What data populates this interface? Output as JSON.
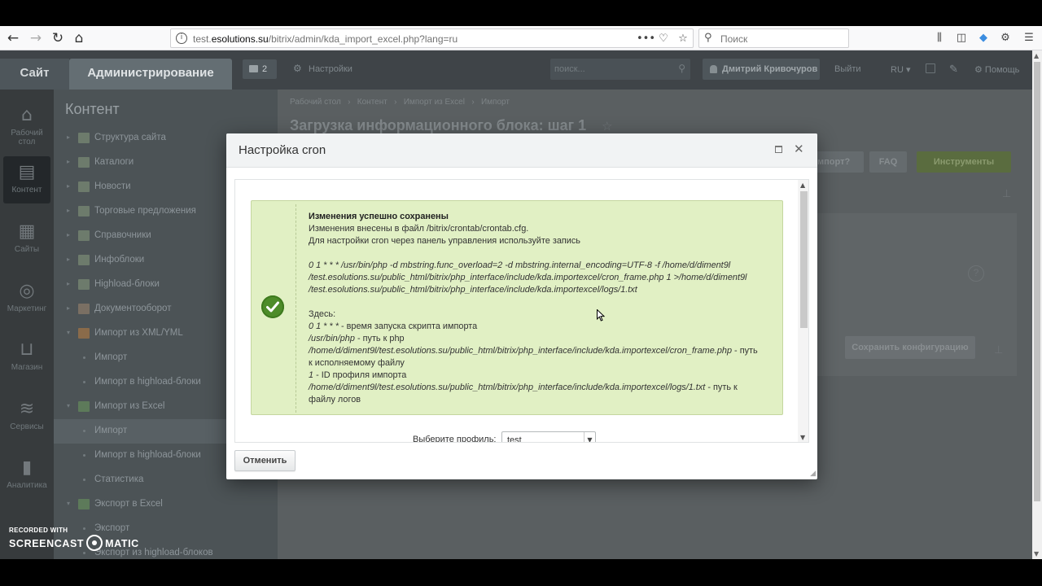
{
  "browser": {
    "url_prefix": "test.",
    "url_domain": "esolutions.su",
    "url_path": "/bitrix/admin/kda_import_excel.php?lang=ru",
    "search_placeholder": "Поиск",
    "more_icon": "•••"
  },
  "header": {
    "site_tab": "Сайт",
    "admin_tab": "Администрирование",
    "notifications_count": "2",
    "settings_label": "Настройки",
    "search_placeholder": "поиск...",
    "user_name": "Дмитрий Кривочуров",
    "logout_label": "Выйти",
    "lang_label": "RU",
    "help_label": "Помощь"
  },
  "leftbar": {
    "items": [
      {
        "label1": "Рабочий",
        "label2": "стол",
        "icon": "home-icon"
      },
      {
        "label1": "Контент",
        "label2": "",
        "icon": "document-icon"
      },
      {
        "label1": "Сайты",
        "label2": "",
        "icon": "calendar-icon"
      },
      {
        "label1": "Маркетинг",
        "label2": "",
        "icon": "target-icon"
      },
      {
        "label1": "Магазин",
        "label2": "",
        "icon": "basket-icon"
      },
      {
        "label1": "Сервисы",
        "label2": "",
        "icon": "layers-icon"
      },
      {
        "label1": "Аналитика",
        "label2": "",
        "icon": "bar-chart-icon"
      }
    ]
  },
  "submenu": {
    "title": "Контент",
    "items": [
      "Структура сайта",
      "Каталоги",
      "Новости",
      "Торговые предложения",
      "Справочники",
      "Инфоблоки",
      "Highload-блоки",
      "Документооборот",
      "Импорт из XML/YML"
    ],
    "xml_children": [
      "Импорт",
      "Импорт в highload-блоки"
    ],
    "excel_group": "Импорт из Excel",
    "excel_children": [
      "Импорт",
      "Импорт в highload-блоки",
      "Статистика"
    ],
    "export_group": "Экспорт в Excel",
    "export_children": [
      "Экспорт",
      "Экспорт из highload-блоков"
    ]
  },
  "main": {
    "breadcrumbs": [
      "Рабочий стол",
      "Контент",
      "Импорт из Excel",
      "Импорт"
    ],
    "title": "Загрузка информационного блока: шаг 1",
    "btn_import": "мпорт?",
    "btn_faq": "FAQ",
    "btn_tools": "Инструменты",
    "btn_save": "Сохранить конфигурацию"
  },
  "dialog": {
    "title": "Настройка cron",
    "message": {
      "heading": "Изменения успешно сохранены",
      "line1": "Изменения внесены в файл /bitrix/crontab/crontab.cfg.",
      "line2": "Для настройки cron через панель управления используйте запись",
      "cmd1": "0 1 * * * /usr/bin/php -d mbstring.func_overload=2 -d mbstring.internal_encoding=UTF-8 -f /home/d/diment9l",
      "cmd2": "/test.esolutions.su/public_html/bitrix/php_interface/include/kda.importexcel/cron_frame.php 1 >/home/d/diment9l",
      "cmd3": "/test.esolutions.su/public_html/bitrix/php_interface/include/kda.importexcel/logs/1.txt",
      "here": "Здесь:",
      "d1_code": "0 1 * * *",
      "d1_text": " - время запуска скрипта импорта",
      "d2_code": "/usr/bin/php",
      "d2_text": " - путь к php",
      "d3_code": "/home/d/diment9l/test.esolutions.su/public_html/bitrix/php_interface/include/kda.importexcel/cron_frame.php",
      "d3_text": " - путь",
      "d3_text2": "к исполняемому файлу",
      "d4_code": "1",
      "d4_text": " - ID профиля импорта",
      "d5_code": "/home/d/diment9l/test.esolutions.su/public_html/bitrix/php_interface/include/kda.importexcel/logs/1.txt",
      "d5_text": " - путь к",
      "d5_text2": "файлу логов"
    },
    "profile_label": "Выберите профиль:",
    "profile_value": "test",
    "cancel_label": "Отменить"
  },
  "watermark": {
    "line1": "RECORDED WITH",
    "line2a": "SCREENCAST",
    "line2b": "MATIC"
  }
}
